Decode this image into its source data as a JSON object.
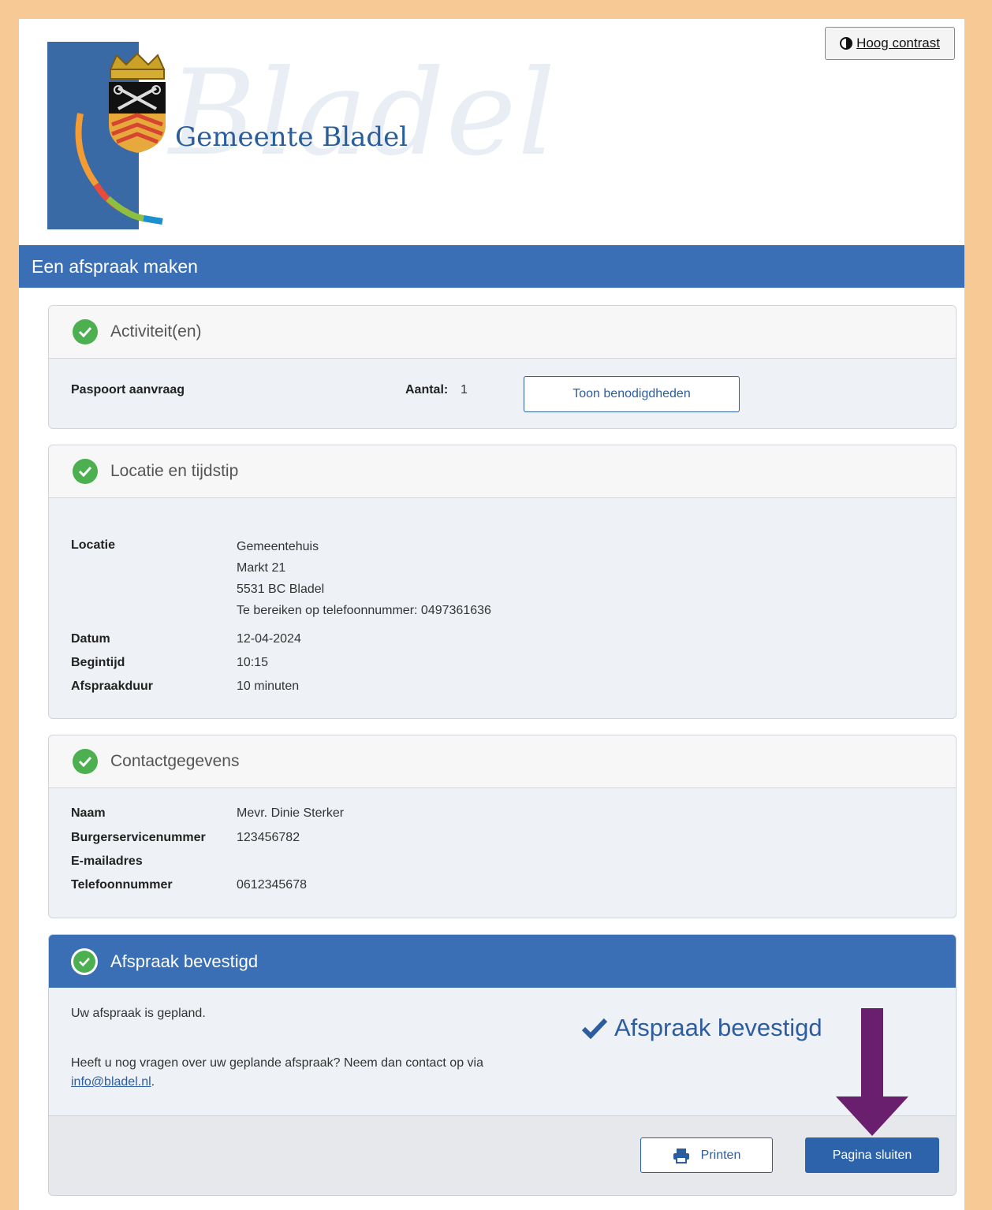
{
  "header": {
    "logo_text": "Gemeente Bladel",
    "logo_watermark": "Bladel",
    "contrast_button": "Hoog contrast"
  },
  "title": "Een afspraak maken",
  "activities": {
    "heading": "Activiteit(en)",
    "item": "Paspoort aanvraag",
    "count_label": "Aantal:",
    "count_value": "1",
    "requirements_button": "Toon benodigdheden"
  },
  "location": {
    "heading": "Locatie en tijdstip",
    "location_label": "Locatie",
    "address_lines": [
      "Gemeentehuis",
      "Markt 21",
      "5531 BC Bladel",
      "Te bereiken op telefoonnummer: 0497361636"
    ],
    "date_label": "Datum",
    "date_value": "12-04-2024",
    "start_label": "Begintijd",
    "start_value": "10:15",
    "duration_label": "Afspraakduur",
    "duration_value": "10 minuten"
  },
  "contact": {
    "heading": "Contactgegevens",
    "name_label": "Naam",
    "name_value": "Mevr. Dinie Sterker",
    "bsn_label": "Burgerservicenummer",
    "bsn_value": "123456782",
    "email_label": "E-mailadres",
    "email_value": "",
    "phone_label": "Telefoonnummer",
    "phone_value": "0612345678"
  },
  "confirmation": {
    "heading": "Afspraak bevestigd",
    "planned_text": "Uw afspraak is gepland.",
    "questions_text": "Heeft u nog vragen over uw geplande afspraak? Neem dan contact op via",
    "email_link": "info@bladel.nl",
    "period": ".",
    "confirmed_badge": "Afspraak bevestigd",
    "print_button": "Printen",
    "close_button": "Pagina sluiten"
  },
  "colors": {
    "frame": "#f7c995",
    "primary_blue": "#3a6fb5",
    "success_green": "#4caf50",
    "annotation_arrow": "#6a1f6e"
  }
}
